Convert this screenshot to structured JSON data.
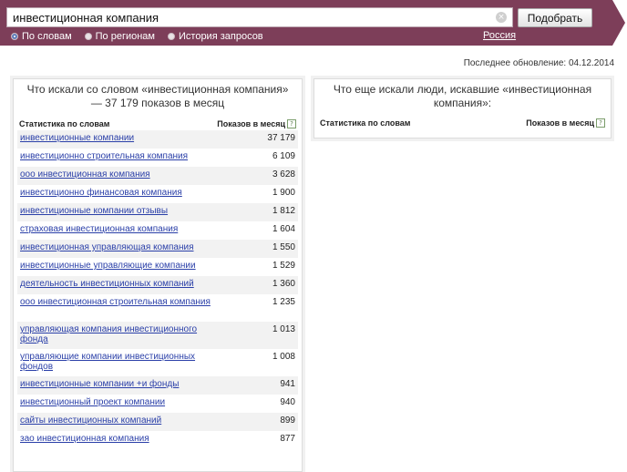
{
  "search": {
    "query": "инвестиционная компания",
    "clear_glyph": "×",
    "button_label": "Подобрать"
  },
  "modes": [
    {
      "label": "По словам",
      "selected": true
    },
    {
      "label": "По регионам",
      "selected": false
    },
    {
      "label": "История запросов",
      "selected": false
    }
  ],
  "region": "Россия",
  "updated": "Последнее обновление: 04.12.2014",
  "left_panel": {
    "title": "Что искали со словом «инвестиционная компания» — 37 179 показов в месяц",
    "col_phrase": "Статистика по словам",
    "col_count": "Показов в месяц",
    "help_glyph": "?",
    "rows": [
      {
        "phrase": "инвестиционные компании",
        "count": "37 179"
      },
      {
        "phrase": "инвестиционно строительная компания",
        "count": "6 109"
      },
      {
        "phrase": "ооо инвестиционная компания",
        "count": "3 628"
      },
      {
        "phrase": "инвестиционно финансовая компания",
        "count": "1 900"
      },
      {
        "phrase": "инвестиционные компании отзывы",
        "count": "1 812"
      },
      {
        "phrase": "страховая инвестиционная компания",
        "count": "1 604"
      },
      {
        "phrase": "инвестиционная управляющая компания",
        "count": "1 550"
      },
      {
        "phrase": "инвестиционные управляющие компании",
        "count": "1 529"
      },
      {
        "phrase": "деятельность инвестиционных компаний",
        "count": "1 360"
      },
      {
        "phrase": "ооо инвестиционная строительная компания",
        "count": "1 235"
      },
      {
        "phrase": "управляющая компания инвестиционного фонда",
        "count": "1 013"
      },
      {
        "phrase": "управляющие компании инвестиционных фондов",
        "count": "1 008"
      },
      {
        "phrase": "инвестиционные компании +и фонды",
        "count": "941"
      },
      {
        "phrase": "инвестиционный проект компании",
        "count": "940"
      },
      {
        "phrase": "сайты инвестиционных компаний",
        "count": "899"
      },
      {
        "phrase": "зао инвестиционная компания",
        "count": "877"
      }
    ]
  },
  "right_panel": {
    "title": "Что еще искали люди, искавшие «инвестиционная компания»:",
    "col_phrase": "Статистика по словам",
    "col_count": "Показов в месяц",
    "help_glyph": "?"
  },
  "colors": {
    "topbar": "#7d3e59",
    "link": "#2a3fa8",
    "row_stripe": "#f2f2f2"
  }
}
